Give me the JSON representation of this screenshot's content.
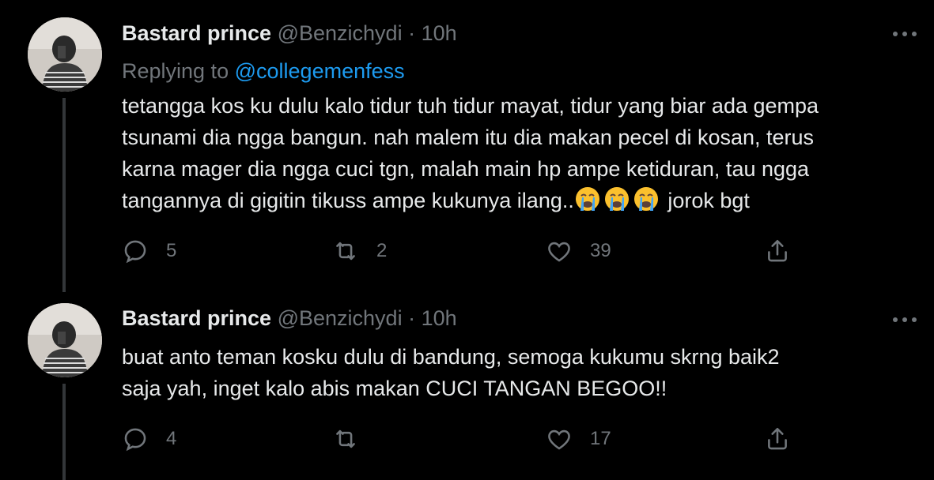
{
  "tweets": [
    {
      "author_name": "Bastard prince",
      "handle": "@Benzichydi",
      "separator": "·",
      "time": "10h",
      "replying_prefix": "Replying to",
      "replying_to": "@collegemenfess",
      "lines": [
        "tetangga kos ku dulu kalo tidur tuh tidur mayat, tidur yang biar ada gempa",
        "tsunami dia ngga bangun. nah malem itu dia makan pecel di kosan, terus",
        "karna mager dia ngga cuci tgn, malah main hp ampe ketiduran, tau ngga",
        "tangannya di gigitin tikuss ampe kukunya ilang.."
      ],
      "emoji_count": 3,
      "emoji_name": "loudly-crying-face",
      "line_tail": "jorok bgt",
      "replies": "5",
      "retweets": "2",
      "likes": "39"
    },
    {
      "author_name": "Bastard prince",
      "handle": "@Benzichydi",
      "separator": "·",
      "time": "10h",
      "lines": [
        "buat anto teman kosku dulu di bandung, semoga kukumu skrng baik2",
        "saja yah, inget kalo abis makan CUCI TANGAN BEGOO!!"
      ],
      "replies": "4",
      "retweets": "",
      "likes": "17"
    }
  ],
  "colors": {
    "background": "#000000",
    "text": "#e7e9ea",
    "muted": "#71767b",
    "link": "#1d9bf0",
    "thread_line": "#333639"
  }
}
